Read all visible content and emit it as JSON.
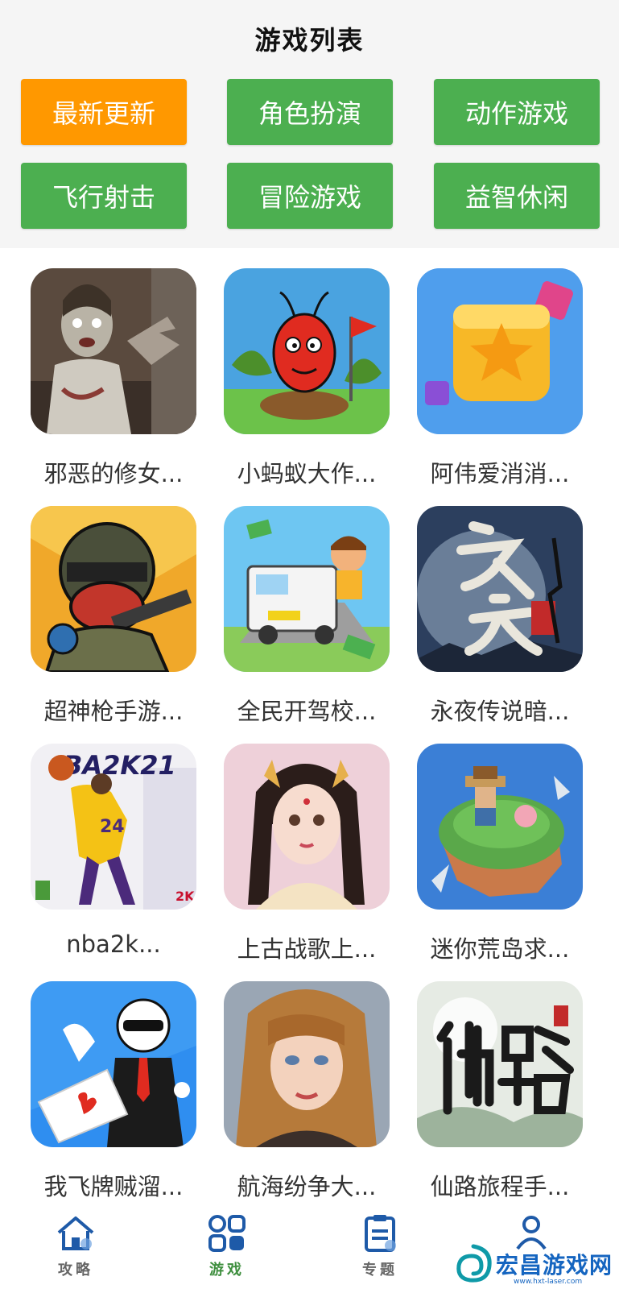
{
  "header": {
    "title": "游戏列表"
  },
  "categories": [
    {
      "label": "最新更新",
      "active": true
    },
    {
      "label": "角色扮演",
      "active": false
    },
    {
      "label": "动作游戏",
      "active": false
    },
    {
      "label": "飞行射击",
      "active": false
    },
    {
      "label": "冒险游戏",
      "active": false
    },
    {
      "label": "益智休闲",
      "active": false
    }
  ],
  "games": [
    {
      "name": "邪恶的修女...",
      "icon": "zombie-nun-icon"
    },
    {
      "name": "小蚂蚁大作...",
      "icon": "red-ant-icon"
    },
    {
      "name": "阿伟爱消消...",
      "icon": "star-cube-icon"
    },
    {
      "name": "超神枪手游...",
      "icon": "gunner-soldier-icon"
    },
    {
      "name": "全民开驾校...",
      "icon": "driving-school-truck-icon"
    },
    {
      "name": "永夜传说暗...",
      "icon": "eternal-night-calligraphy-icon"
    },
    {
      "name": "nba2k...",
      "icon": "nba2k21-cover-icon"
    },
    {
      "name": "上古战歌上...",
      "icon": "ancient-heroine-portrait-icon"
    },
    {
      "name": "迷你荒岛求...",
      "icon": "pixel-island-icon"
    },
    {
      "name": "我飞牌贼溜...",
      "icon": "card-thrower-agent-icon"
    },
    {
      "name": "航海纷争大...",
      "icon": "sailor-girl-portrait-icon"
    },
    {
      "name": "仙路旅程手...",
      "icon": "xianlu-calligraphy-icon"
    }
  ],
  "tabs": [
    {
      "label": "攻略",
      "icon": "home-icon",
      "active": false
    },
    {
      "label": "游戏",
      "icon": "grid-apps-icon",
      "active": true
    },
    {
      "label": "专题",
      "icon": "clipboard-icon",
      "active": false
    },
    {
      "label": "",
      "icon": "user-icon",
      "active": false
    }
  ],
  "watermark": {
    "text": "宏昌游戏网",
    "sub": "www.hxt-laser.com",
    "icon": "swirl-logo-icon"
  },
  "colors": {
    "accent_active": "#ff9800",
    "accent": "#4caf50",
    "tab_active": "#3f8f3f",
    "tab_icon": "#1e5aa8"
  }
}
